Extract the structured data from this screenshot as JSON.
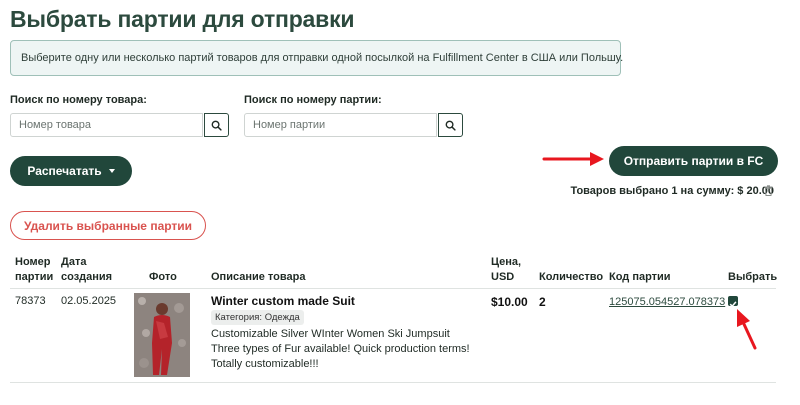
{
  "page": {
    "title": "Выбрать партии для отправки",
    "info": "Выберите одну или несколько партий товаров для отправки одной посылкой на Fulfillment Center в США или Польшу."
  },
  "search": {
    "product": {
      "label": "Поиск по номеру товара:",
      "placeholder": "Номер товара"
    },
    "batch": {
      "label": "Поиск по номеру партии:",
      "placeholder": "Номер партии"
    }
  },
  "actions": {
    "print_label": "Распечатать",
    "send_label": "Отправить партии в FC",
    "delete_label": "Удалить выбранные партии",
    "summary": "Товаров выбрано 1 на сумму: $ 20.00"
  },
  "table": {
    "headers": {
      "product_number": [
        "Номер",
        "партии"
      ],
      "created": [
        "Дата",
        "создания"
      ],
      "photo": "Фото",
      "description": "Описание товара",
      "price": [
        "Цена,",
        "USD"
      ],
      "quantity": "Количество",
      "batch_code": "Код партии",
      "select": "Выбрать"
    },
    "rows": [
      {
        "number": "78373",
        "date": "02.05.2025",
        "name": "Winter custom made Suit",
        "category": "Категория: Одежда",
        "description": "Customizable Silver WInter Women Ski Jumpsuit Three types of Fur available! Quick production terms! Totally customizable!!!",
        "price": "$10.00",
        "quantity": "2",
        "batch_code": "125075.054527.078373",
        "selected": true
      }
    ]
  },
  "colors": {
    "brand": "#21473b",
    "title": "#2c4a3e",
    "danger": "#d9534f",
    "info_bg": "#eef5f4",
    "annotation": "#e8171f"
  },
  "icons": [
    "search-icon",
    "caret-down-icon",
    "trash-icon",
    "checkmark-icon",
    "arrow-annotation"
  ]
}
